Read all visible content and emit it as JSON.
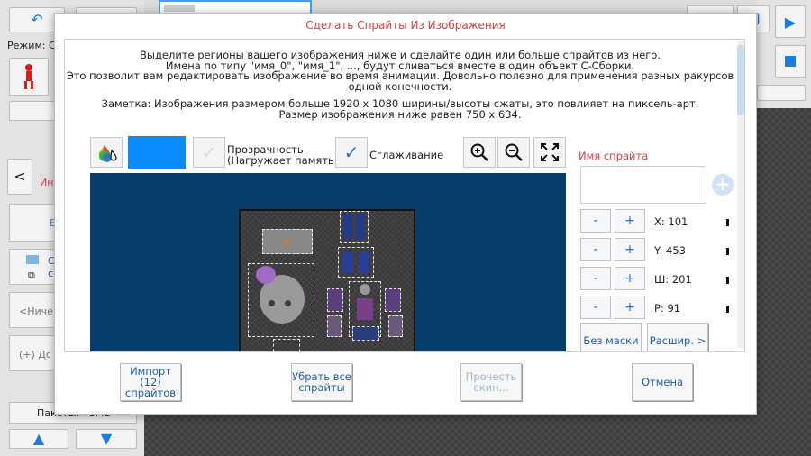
{
  "background": {
    "mode_label": "Режим: С",
    "left_red_text": "Ин",
    "left_text_1": "В",
    "left_text_2a": "С",
    "left_text_2b": "с",
    "left_placeholder": "<Ниче",
    "left_add": "(+) Дс",
    "packages_label": "Пакеты: 43МБ"
  },
  "modal": {
    "title": "Сделать Спрайты Из Изображения",
    "description": [
      "Выделите регионы вашего изображения ниже и сделайте один или больше спрайтов из него.",
      "Имена по типу \"имя_0\", \"имя_1\", ...,  будут сливаться вместе в один объект С-Сборки.",
      "Это позволит вам редактировать изображение во время анимации. Довольно полезно для применения разных ракурсов",
      "одной конечности."
    ],
    "note": [
      "Заметка: Изображения размером больше 1920 x 1080 ширины/высоты сжаты, это повлияет на пиксель-арт.",
      "Размер изображения ниже равен 750 x 634."
    ],
    "transparency_label_1": "Прозрачность",
    "transparency_label_2": "(Нагружает память)",
    "smoothing_label": "Сглаживание",
    "checkmark": "✓",
    "sprite_name_label": "Имя спрайта",
    "sprite_name_value": "",
    "fields": [
      {
        "label": "X: 101"
      },
      {
        "label": "Y: 453"
      },
      {
        "label": "Ш: 201"
      },
      {
        "label": "Р: 91"
      }
    ],
    "minus": "-",
    "plus": "+",
    "add_symbol": "+",
    "no_mask_label": "Без маски",
    "expand_label": "Расшир. >",
    "import_label": [
      "Импорт",
      "(12)",
      "спрайтов"
    ],
    "remove_all_label": [
      "Убрать все",
      "спрайты"
    ],
    "read_skin_label": [
      "Прочесть",
      "скин..."
    ],
    "cancel_label": "Отмена",
    "colors": {
      "accent": "#0a8cff",
      "title": "#e23b3b",
      "canvas_bg": "#073e6b"
    }
  }
}
